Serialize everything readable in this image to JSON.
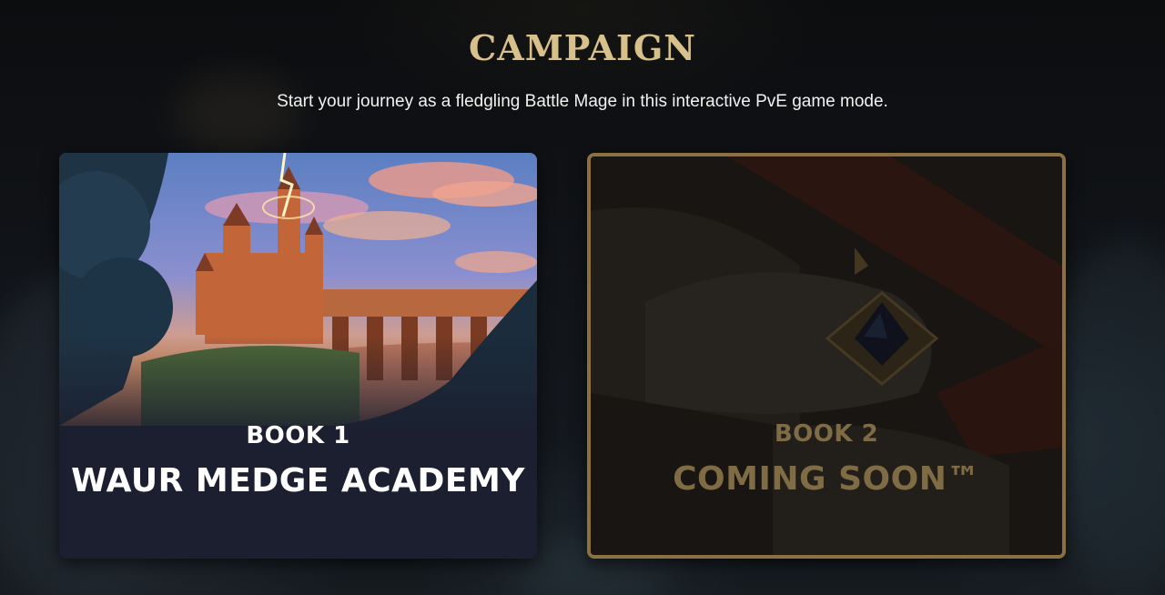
{
  "header": {
    "title": "CAMPAIGN",
    "subtitle": "Start your journey as a fledgling Battle Mage in this interactive PvE game mode."
  },
  "books": [
    {
      "number": "BOOK 1",
      "name": "WAUR MEDGE ACADEMY",
      "status": "available"
    },
    {
      "number": "BOOK 2",
      "name": "COMING SOON™",
      "status": "locked"
    }
  ],
  "colors": {
    "title_gold": "#d8c08b",
    "card_border_gold": "#8c7042",
    "locked_text": "#7f6c45",
    "page_bg": "#0e1013",
    "card_bg": "#1b1f2f"
  }
}
